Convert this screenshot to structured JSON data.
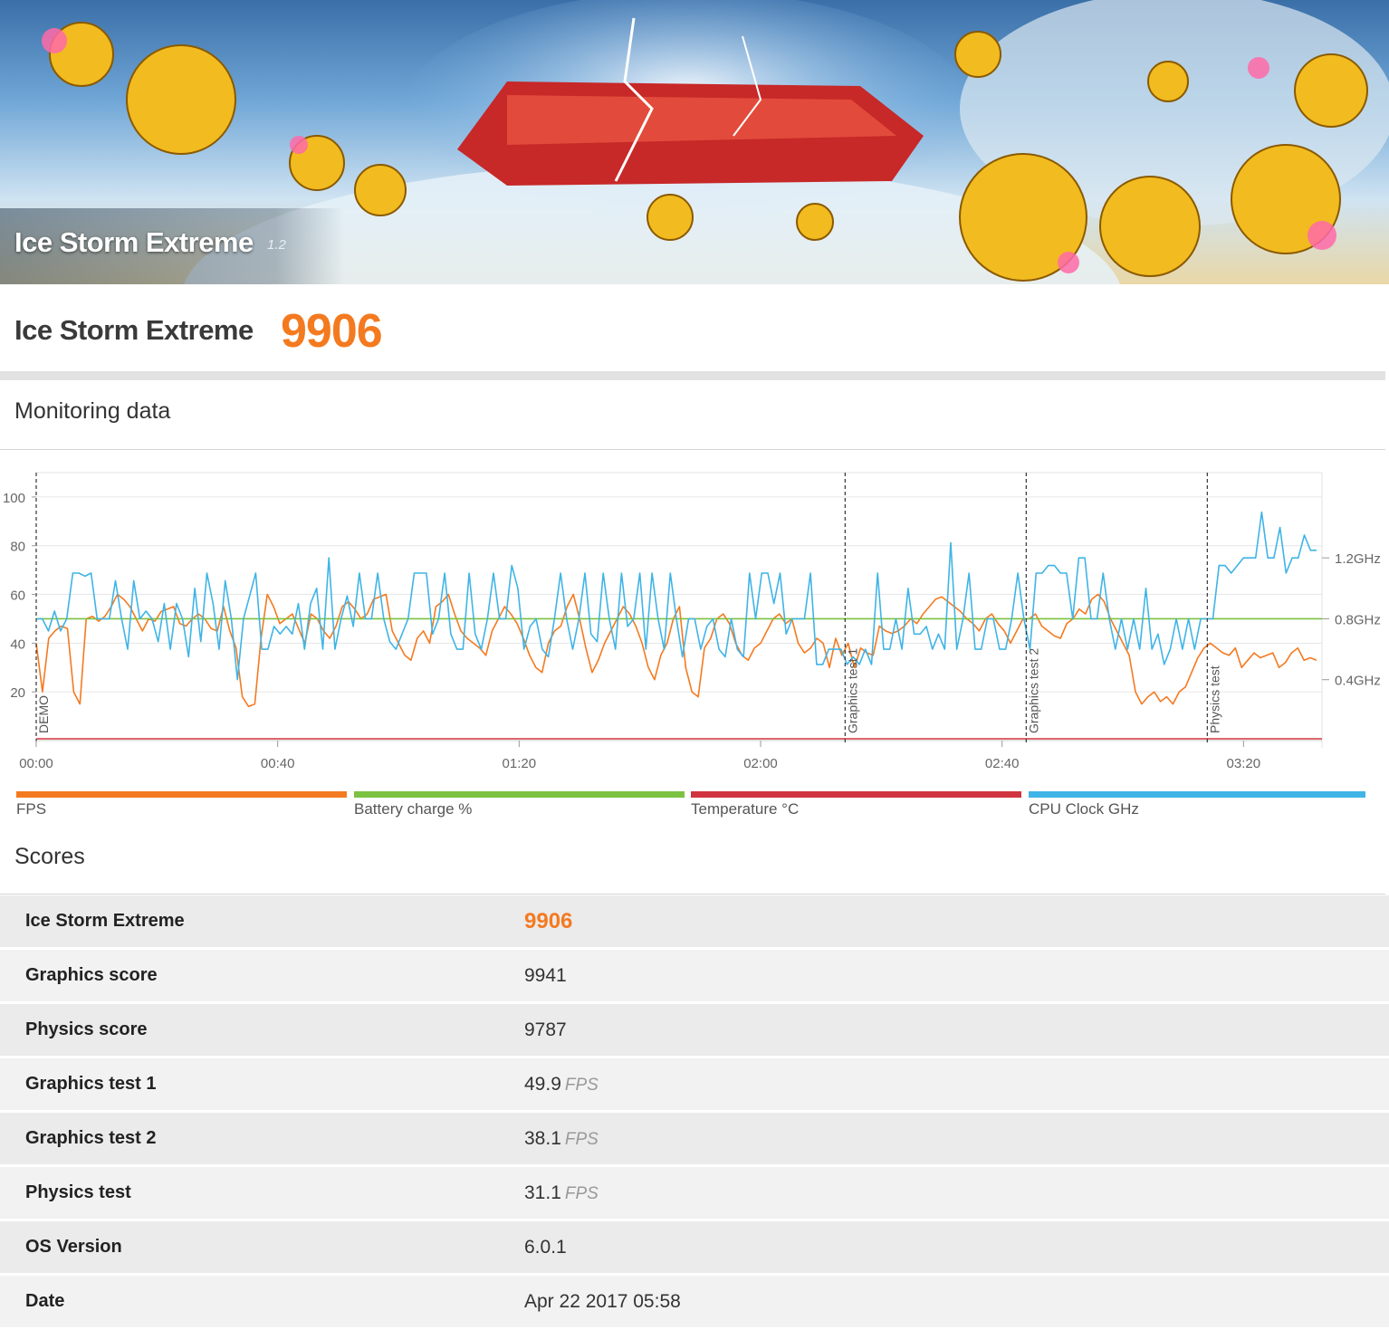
{
  "banner": {
    "title": "Ice Storm Extreme",
    "version": "1.2"
  },
  "header": {
    "name": "Ice Storm Extreme",
    "score": "9906"
  },
  "sections": {
    "monitoring": "Monitoring data",
    "scores": "Scores"
  },
  "legend": [
    {
      "label": "FPS",
      "color": "#f47a20"
    },
    {
      "label": "Battery charge %",
      "color": "#7cc242"
    },
    {
      "label": "Temperature °C",
      "color": "#d0343f"
    },
    {
      "label": "CPU Clock GHz",
      "color": "#3fb4e6"
    }
  ],
  "colors": {
    "accent": "#f47a20"
  },
  "chart_data": {
    "type": "line",
    "x_ticks": [
      "00:00",
      "00:40",
      "01:20",
      "02:00",
      "02:40",
      "03:20"
    ],
    "y_left_ticks": [
      "20",
      "40",
      "60",
      "80",
      "100"
    ],
    "y_right_ticks": [
      "0.4GHz",
      "0.8GHz",
      "1.2GHz"
    ],
    "xlim_seconds": [
      0,
      213
    ],
    "ylim": [
      0,
      110
    ],
    "markers": [
      {
        "label": "DEMO",
        "t": 0
      },
      {
        "label": "Graphics test 1",
        "t": 134
      },
      {
        "label": "Graphics test 2",
        "t": 164
      },
      {
        "label": "Physics test",
        "t": 194
      }
    ],
    "series": [
      {
        "name": "FPS",
        "color": "#f47a20",
        "values": [
          40,
          20,
          42,
          45,
          47,
          46,
          20,
          15,
          50,
          51,
          49,
          51,
          55,
          60,
          58,
          55,
          50,
          45,
          50,
          49,
          53,
          54,
          55,
          48,
          47,
          50,
          52,
          50,
          46,
          45,
          55,
          45,
          38,
          18,
          14,
          15,
          42,
          60,
          55,
          48,
          50,
          52,
          46,
          40,
          52,
          50,
          45,
          42,
          47,
          55,
          57,
          54,
          50,
          52,
          58,
          59,
          60,
          45,
          40,
          35,
          33,
          42,
          45,
          40,
          55,
          57,
          60,
          52,
          45,
          42,
          40,
          38,
          35,
          45,
          50,
          55,
          52,
          48,
          42,
          35,
          30,
          28,
          40,
          45,
          47,
          55,
          60,
          50,
          38,
          28,
          33,
          40,
          45,
          50,
          55,
          52,
          47,
          40,
          30,
          25,
          35,
          40,
          50,
          55,
          30,
          20,
          18,
          38,
          42,
          50,
          52,
          48,
          40,
          35,
          33,
          38,
          40,
          45,
          50,
          52,
          48,
          50,
          40,
          36,
          38,
          42,
          40,
          30,
          42,
          35,
          40,
          30,
          38,
          36,
          35,
          47,
          45,
          44,
          45,
          47,
          50,
          48,
          52,
          55,
          58,
          59,
          57,
          55,
          53,
          50,
          48,
          45,
          50,
          52,
          48,
          45,
          40,
          45,
          50,
          50,
          52,
          47,
          45,
          43,
          42,
          48,
          50,
          54,
          52,
          58,
          60,
          57,
          50,
          45,
          40,
          35,
          20,
          15,
          18,
          20,
          16,
          18,
          15,
          20,
          22,
          28,
          34,
          38,
          40,
          38,
          36,
          35,
          38,
          30,
          33,
          36,
          34,
          35,
          36,
          30,
          32,
          36,
          38,
          33,
          34,
          33
        ]
      },
      {
        "name": "Battery charge %",
        "color": "#7cc242",
        "constant": 50
      },
      {
        "name": "Temperature °C",
        "color": "#d0343f",
        "constant": 0
      },
      {
        "name": "CPU Clock GHz",
        "color": "#3fb4e6",
        "values": [
          0.8,
          0.8,
          0.72,
          0.85,
          0.72,
          0.8,
          1.1,
          1.1,
          1.08,
          1.1,
          0.8,
          0.8,
          0.8,
          1.05,
          0.8,
          0.6,
          1.05,
          0.8,
          0.85,
          0.8,
          0.65,
          0.9,
          0.6,
          0.9,
          0.8,
          0.55,
          1.0,
          0.65,
          1.1,
          0.9,
          0.6,
          1.05,
          0.8,
          0.4,
          0.8,
          0.95,
          1.1,
          0.6,
          0.6,
          0.75,
          0.7,
          0.75,
          0.7,
          0.9,
          0.6,
          0.9,
          1.0,
          0.6,
          1.2,
          0.6,
          0.8,
          0.95,
          0.75,
          1.1,
          0.8,
          0.8,
          1.1,
          0.8,
          0.65,
          0.6,
          0.7,
          0.8,
          1.1,
          1.1,
          1.1,
          0.7,
          0.8,
          1.1,
          0.7,
          0.6,
          0.6,
          1.1,
          0.7,
          0.6,
          0.8,
          1.1,
          0.8,
          0.8,
          1.15,
          1.0,
          0.6,
          0.75,
          0.8,
          0.6,
          0.55,
          0.8,
          1.1,
          0.8,
          0.6,
          0.8,
          1.1,
          0.7,
          0.65,
          1.1,
          0.8,
          0.6,
          1.1,
          0.75,
          0.8,
          1.1,
          0.6,
          1.1,
          0.8,
          0.6,
          1.1,
          0.8,
          0.55,
          0.8,
          0.8,
          0.6,
          0.75,
          0.8,
          0.6,
          0.55,
          0.8,
          0.6,
          0.55,
          1.1,
          0.8,
          1.1,
          1.1,
          0.9,
          1.1,
          0.7,
          0.8,
          0.8,
          0.8,
          1.1,
          0.5,
          0.5,
          0.6,
          0.6,
          0.6,
          0.5,
          0.55,
          0.5,
          0.6,
          0.5,
          1.1,
          0.6,
          0.6,
          0.8,
          0.6,
          1.0,
          0.7,
          0.7,
          0.75,
          0.6,
          0.7,
          0.6,
          1.3,
          0.6,
          0.8,
          1.1,
          0.6,
          0.6,
          0.8,
          0.8,
          0.6,
          0.6,
          0.8,
          1.1,
          0.8,
          0.6,
          1.1,
          1.1,
          1.15,
          1.15,
          1.1,
          1.1,
          0.8,
          1.2,
          1.2,
          0.8,
          0.8,
          1.1,
          0.8,
          0.6,
          0.8,
          0.6,
          0.8,
          0.6,
          1.0,
          0.6,
          0.7,
          0.5,
          0.6,
          0.8,
          0.6,
          0.8,
          0.6,
          0.8,
          0.8,
          0.8,
          1.15,
          1.15,
          1.1,
          1.15,
          1.2,
          1.2,
          1.2,
          1.5,
          1.2,
          1.2,
          1.4,
          1.1,
          1.2,
          1.2,
          1.35,
          1.25,
          1.25
        ]
      }
    ]
  },
  "scores": [
    {
      "label": "Ice Storm Extreme",
      "value": "9906",
      "unit": "",
      "highlight": true
    },
    {
      "label": "Graphics score",
      "value": "9941",
      "unit": ""
    },
    {
      "label": "Physics score",
      "value": "9787",
      "unit": ""
    },
    {
      "label": "Graphics test 1",
      "value": "49.9",
      "unit": "FPS"
    },
    {
      "label": "Graphics test 2",
      "value": "38.1",
      "unit": "FPS"
    },
    {
      "label": "Physics test",
      "value": "31.1",
      "unit": "FPS"
    },
    {
      "label": "OS Version",
      "value": "6.0.1",
      "unit": ""
    },
    {
      "label": "Date",
      "value": "Apr 22 2017 05:58",
      "unit": ""
    }
  ]
}
